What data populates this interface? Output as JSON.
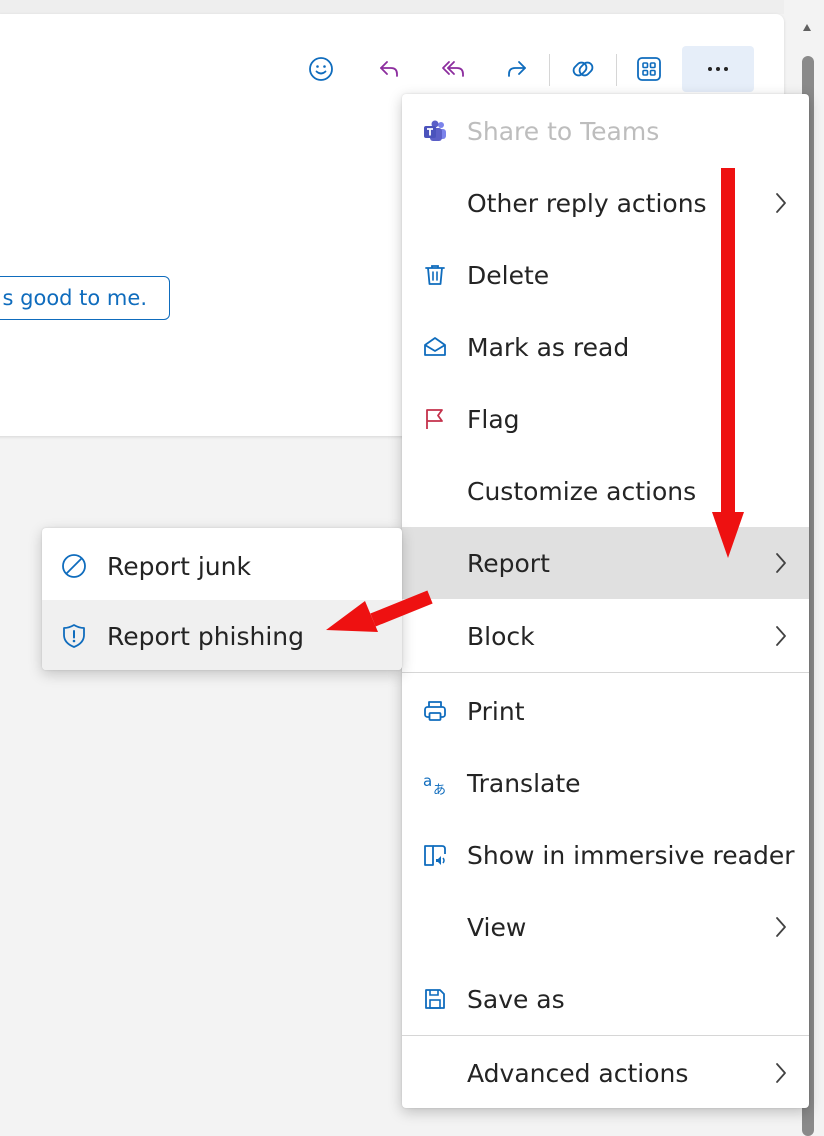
{
  "colors": {
    "accent": "#0f6cbd",
    "reply_purple": "#8c2d9e",
    "flag_red": "#c4314b",
    "annotation_arrow": "#ee1111",
    "teams": "#5b5fc7"
  },
  "toolbar": {
    "buttons": [
      {
        "name": "emoji-button",
        "icon": "smiley-icon"
      },
      {
        "name": "reply-button",
        "icon": "reply-icon"
      },
      {
        "name": "reply-all-button",
        "icon": "reply-all-icon"
      },
      {
        "name": "forward-button",
        "icon": "forward-icon"
      },
      {
        "name": "loop-button",
        "icon": "loop-icon"
      },
      {
        "name": "apps-button",
        "icon": "apps-grid-icon"
      },
      {
        "name": "more-actions-button",
        "icon": "more-icon"
      }
    ]
  },
  "suggested_reply": "s good to me.",
  "menu": {
    "share_teams": "Share to Teams",
    "other_reply": "Other reply actions",
    "delete": "Delete",
    "mark_read": "Mark as read",
    "flag": "Flag",
    "customize": "Customize actions",
    "report": "Report",
    "block": "Block",
    "print": "Print",
    "translate": "Translate",
    "immersive": "Show in immersive reader",
    "view": "View",
    "save_as": "Save as",
    "advanced": "Advanced actions"
  },
  "submenu": {
    "report_junk": "Report junk",
    "report_phishing": "Report phishing"
  }
}
